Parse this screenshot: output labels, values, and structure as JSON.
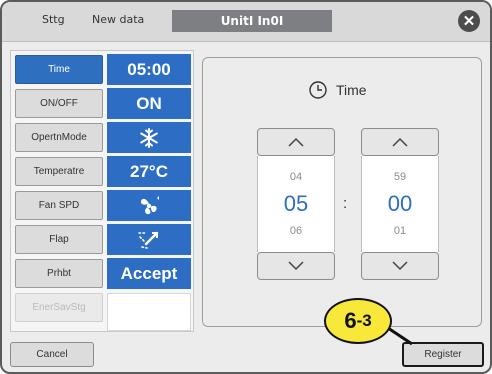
{
  "header": {
    "settings_label": "Sttg",
    "mode_label": "New data",
    "unit_label": "UnitI In0I"
  },
  "items": [
    {
      "label": "Time",
      "selected": true,
      "disabled": false,
      "value": "05:00",
      "value_icon": ""
    },
    {
      "label": "ON/OFF",
      "selected": false,
      "disabled": false,
      "value": "ON",
      "value_icon": ""
    },
    {
      "label": "OpertnMode",
      "selected": false,
      "disabled": false,
      "value": "",
      "value_icon": "snowflake-icon"
    },
    {
      "label": "Temperatre",
      "selected": false,
      "disabled": false,
      "value": "27°C",
      "value_icon": ""
    },
    {
      "label": "Fan SPD",
      "selected": false,
      "disabled": false,
      "value": "",
      "value_icon": "fan-icon"
    },
    {
      "label": "Flap",
      "selected": false,
      "disabled": false,
      "value": "",
      "value_icon": "flap-swing-icon"
    },
    {
      "label": "Prhbt",
      "selected": false,
      "disabled": false,
      "value": "Accept",
      "value_icon": ""
    },
    {
      "label": "EnerSavStg",
      "selected": false,
      "disabled": true,
      "value": "",
      "value_icon": ""
    }
  ],
  "editor": {
    "title": "Time",
    "hours": {
      "prev": "04",
      "current": "05",
      "next": "06"
    },
    "minutes": {
      "prev": "59",
      "current": "00",
      "next": "01"
    },
    "separator": ":"
  },
  "footer": {
    "cancel_label": "Cancel",
    "register_label": "Register"
  },
  "annotation": {
    "step": "6",
    "sub": "-3"
  },
  "colors": {
    "accent": "#2d6ec4",
    "selected_item": "#2f6fbf",
    "callout": "#f7e83a"
  }
}
